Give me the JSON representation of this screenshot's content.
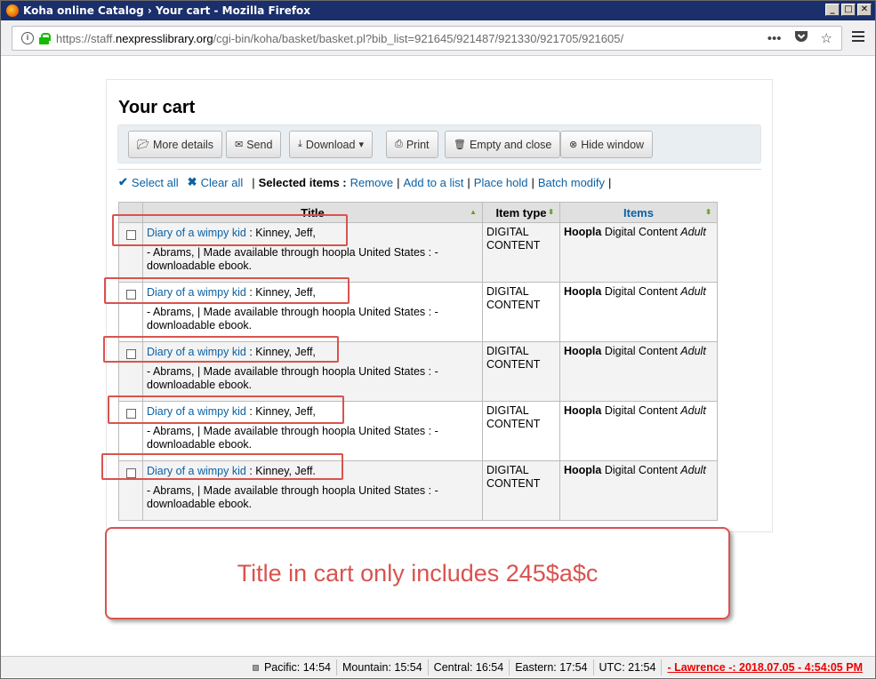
{
  "window": {
    "title": "Koha online Catalog › Your cart - Mozilla Firefox",
    "controls": [
      "_",
      "□",
      "✕"
    ]
  },
  "urlbar": {
    "prefix": "https://staff.",
    "domain": "nexpresslibrary.org",
    "path": "/cgi-bin/koha/basket/basket.pl?bib_list=921645/921487/921330/921705/921605/"
  },
  "page": {
    "title": "Your cart",
    "toolbar": {
      "more_details": "More details",
      "send": "Send",
      "download": "Download",
      "print": "Print",
      "empty_close": "Empty and close",
      "hide_window": "Hide window"
    },
    "selection": {
      "select_all": "Select all",
      "clear_all": "Clear all",
      "selected_items": "Selected items :",
      "remove": "Remove",
      "add_to_list": "Add to a list",
      "place_hold": "Place hold",
      "batch_modify": "Batch modify"
    },
    "table": {
      "headers": {
        "title": "Title",
        "item_type": "Item type",
        "items": "Items"
      },
      "rows": [
        {
          "title_link": "Diary of a wimpy kid",
          "author": " : Kinney, Jeff,",
          "desc": "- Abrams, | Made available through hoopla United States : - downloadable ebook.",
          "item_type": "DIGITAL CONTENT",
          "items_bold": "Hoopla",
          "items_mid": " Digital Content ",
          "items_italic": "Adult"
        },
        {
          "title_link": "Diary of a wimpy kid",
          "author": " : Kinney, Jeff,",
          "desc": "- Abrams, | Made available through hoopla United States : - downloadable ebook.",
          "item_type": "DIGITAL CONTENT",
          "items_bold": "Hoopla",
          "items_mid": " Digital Content ",
          "items_italic": "Adult"
        },
        {
          "title_link": "Diary of a wimpy kid",
          "author": " : Kinney, Jeff,",
          "desc": "- Abrams, | Made available through hoopla United States : - downloadable ebook.",
          "item_type": "DIGITAL CONTENT",
          "items_bold": "Hoopla",
          "items_mid": " Digital Content ",
          "items_italic": "Adult"
        },
        {
          "title_link": "Diary of a wimpy kid",
          "author": " : Kinney, Jeff,",
          "desc": "- Abrams, | Made available through hoopla United States : - downloadable ebook.",
          "item_type": "DIGITAL CONTENT",
          "items_bold": "Hoopla",
          "items_mid": " Digital Content ",
          "items_italic": "Adult"
        },
        {
          "title_link": "Diary of a wimpy kid",
          "author": " : Kinney, Jeff.",
          "desc": "- Abrams, | Made available through hoopla United States : - downloadable ebook.",
          "item_type": "DIGITAL CONTENT",
          "items_bold": "Hoopla",
          "items_mid": " Digital Content ",
          "items_italic": "Adult"
        }
      ]
    }
  },
  "annotation": {
    "callout_text": "Title in cart only includes 245$a$c",
    "color": "#d9534f"
  },
  "statusbar": {
    "pacific": "Pacific: 14:54",
    "mountain": "Mountain: 15:54",
    "central": "Central: 16:54",
    "eastern": "Eastern: 17:54",
    "utc": "UTC: 21:54",
    "clock": "- Lawrence -: 2018.07.05 - 4:54:05 PM"
  }
}
